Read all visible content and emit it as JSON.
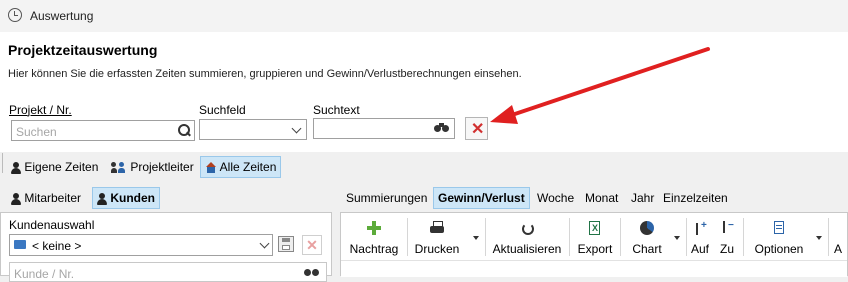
{
  "window": {
    "title": "Auswertung"
  },
  "header": {
    "title": "Projektzeitauswertung",
    "subtitle": "Hier können Sie die erfassten Zeiten summieren, gruppieren und Gewinn/Verlustberechnungen einsehen."
  },
  "search": {
    "project_label": "Projekt / Nr.",
    "project_placeholder": "Suchen",
    "field_label": "Suchfeld",
    "field_value": "",
    "text_label": "Suchtext",
    "text_value": ""
  },
  "scope_tabs": [
    {
      "label": "Eigene Zeiten",
      "selected": false
    },
    {
      "label": "Projektleiter",
      "selected": false
    },
    {
      "label": "Alle Zeiten",
      "selected": true
    }
  ],
  "left_tabs": [
    {
      "label": "Mitarbeiter",
      "selected": false
    },
    {
      "label": "Kunden",
      "selected": true
    }
  ],
  "left_panel": {
    "group_label": "Kundenauswahl",
    "selected_customer": "< keine >",
    "customer_search_placeholder": "Kunde / Nr."
  },
  "right_tabs": [
    {
      "label": "Summierungen",
      "selected": false
    },
    {
      "label": "Gewinn/Verlust",
      "selected": true
    },
    {
      "label": "Woche",
      "selected": false
    },
    {
      "label": "Monat",
      "selected": false
    },
    {
      "label": "Jahr",
      "selected": false
    },
    {
      "label": "Einzelzeiten",
      "selected": false
    }
  ],
  "toolbar": {
    "nachtrag": "Nachtrag",
    "drucken": "Drucken",
    "aktualisieren": "Aktualisieren",
    "export": "Export",
    "chart": "Chart",
    "auf": "Auf",
    "zu": "Zu",
    "optionen": "Optionen",
    "overflow": "A"
  },
  "colors": {
    "accent_tab": "#cde6f7",
    "arrow": "#e02020",
    "clear": "#d13030"
  }
}
